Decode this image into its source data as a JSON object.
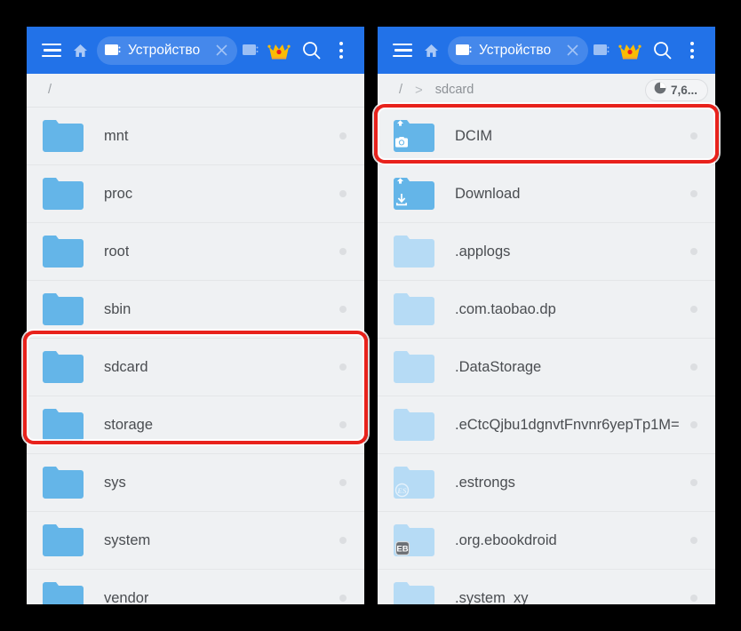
{
  "theme": {
    "toolbar_blue": "#2272e8",
    "list_background": "#eff1f3",
    "folder_blue": "#64b5e8",
    "folder_blue_hidden": "#b6dbf5",
    "highlight_red": "#e8221c",
    "text_gray": "#4a4d51",
    "crumb_gray": "#9a9ea3",
    "outer_background": "#000000"
  },
  "toolbar": {
    "menu_icon": "hamburger-menu-icon",
    "home_icon": "home-icon",
    "tab": {
      "icon": "window-tab-icon",
      "label": "Устройство",
      "close_icon": "close-icon"
    },
    "new_tab_icon": "new-tab-icon",
    "premium_icon": "crown-icon",
    "search_icon": "search-icon",
    "overflow_icon": "overflow-menu-icon"
  },
  "panels": [
    {
      "id": "left",
      "breadcrumb": {
        "segments": [
          "/"
        ],
        "separator": ">"
      },
      "storage_badge": null,
      "items": [
        {
          "name": "mnt",
          "icon": "folder-icon",
          "hidden": false,
          "badge": null
        },
        {
          "name": "proc",
          "icon": "folder-icon",
          "hidden": false,
          "badge": null
        },
        {
          "name": "root",
          "icon": "folder-icon",
          "hidden": false,
          "badge": null
        },
        {
          "name": "sbin",
          "icon": "folder-icon",
          "hidden": false,
          "badge": null
        },
        {
          "name": "sdcard",
          "icon": "folder-icon",
          "hidden": false,
          "badge": null
        },
        {
          "name": "storage",
          "icon": "folder-icon",
          "hidden": false,
          "badge": null
        },
        {
          "name": "sys",
          "icon": "folder-icon",
          "hidden": false,
          "badge": null
        },
        {
          "name": "system",
          "icon": "folder-icon",
          "hidden": false,
          "badge": null
        },
        {
          "name": "vendor",
          "icon": "folder-icon",
          "hidden": false,
          "badge": null
        }
      ]
    },
    {
      "id": "right",
      "breadcrumb": {
        "segments": [
          "/",
          "sdcard"
        ],
        "separator": ">"
      },
      "storage_badge": {
        "icon": "pie-chart-icon",
        "text": "7,6..."
      },
      "items": [
        {
          "name": "DCIM",
          "icon": "folder-camera-icon",
          "hidden": false,
          "badge": "camera"
        },
        {
          "name": "Download",
          "icon": "folder-download-icon",
          "hidden": false,
          "badge": "download"
        },
        {
          "name": ".applogs",
          "icon": "folder-icon",
          "hidden": true,
          "badge": null
        },
        {
          "name": ".com.taobao.dp",
          "icon": "folder-icon",
          "hidden": true,
          "badge": null
        },
        {
          "name": ".DataStorage",
          "icon": "folder-icon",
          "hidden": true,
          "badge": null
        },
        {
          "name": ".eCtcQjbu1dgnvtFnvnr6yepTp1M=",
          "icon": "folder-icon",
          "hidden": true,
          "badge": null
        },
        {
          "name": ".estrongs",
          "icon": "folder-es-icon",
          "hidden": true,
          "badge": "ES"
        },
        {
          "name": ".org.ebookdroid",
          "icon": "folder-eb-icon",
          "hidden": true,
          "badge": "EB"
        },
        {
          "name": ".system_xy",
          "icon": "folder-icon",
          "hidden": true,
          "badge": null
        }
      ]
    }
  ],
  "annotations": [
    {
      "target_panel": "left",
      "items": [
        "sdcard",
        "storage"
      ],
      "shape": "rounded-rectangle",
      "color": "#e8221c"
    },
    {
      "target_panel": "right",
      "items": [
        "DCIM"
      ],
      "shape": "rounded-rectangle",
      "color": "#e8221c"
    }
  ]
}
